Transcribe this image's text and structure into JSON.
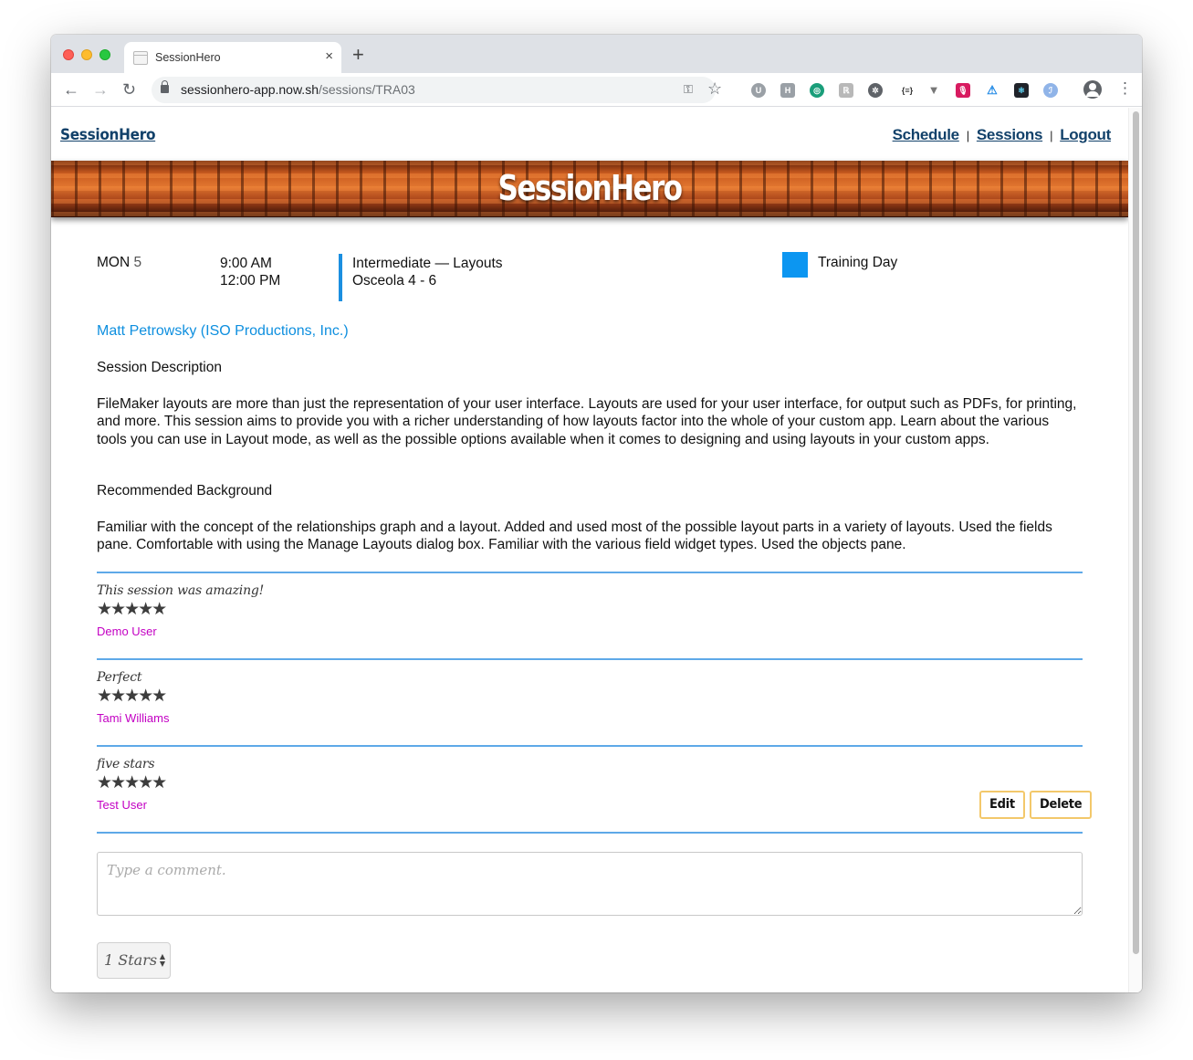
{
  "browser": {
    "tab_title": "SessionHero",
    "tab_close": "×",
    "new_tab": "+",
    "url_host": "sessionhero-app.now.sh",
    "url_path": "/sessions/TRA03",
    "nav_back": "←",
    "nav_forward": "→",
    "nav_reload": "↻",
    "menu": "⋮",
    "extensions": [
      "U",
      "H",
      "◎",
      "ℝ",
      "✲",
      "{≡}",
      "▼",
      "🎙",
      "⚠",
      "⚛",
      "ℐ"
    ]
  },
  "page": {
    "brand": "SessionHero",
    "nav": [
      "Schedule",
      "Sessions",
      "Logout"
    ],
    "nav_separator": "|",
    "hero_title": "SessionHero"
  },
  "session": {
    "day_name": "MON",
    "day_num": "5",
    "start_time": "9:00 AM",
    "end_time": "12:00 PM",
    "title": "Intermediate — Layouts",
    "room": "Osceola 4 - 6",
    "track": "Training Day",
    "track_color": "#0c96f1",
    "speaker": "Matt Petrowsky (ISO Productions, Inc.)",
    "description_heading": "Session Description",
    "description": "FileMaker layouts are more than just the representation of your user interface. Layouts are used for your user interface, for output such as PDFs, for printing, and more. This session aims to provide you with a richer understanding of how layouts factor into the whole of your custom app. Learn about the various tools you can use in Layout mode, as well as the possible options available when it comes to designing and using layouts in your custom apps.",
    "background_heading": "Recommended Background",
    "background": "Familiar with the concept of the relationships graph and a layout. Added and used most of the possible layout parts in a variety of layouts. Used the fields pane. Comfortable with using the Manage Layouts dialog box. Familiar with the various field widget types. Used the objects pane."
  },
  "reviews": [
    {
      "text": "This session was amazing!",
      "stars": "★★★★★",
      "rating": 5,
      "user": "Demo User"
    },
    {
      "text": "Perfect",
      "stars": "★★★★★",
      "rating": 5,
      "user": "Tami Williams"
    },
    {
      "text": "five stars",
      "stars": "★★★★★",
      "rating": 5,
      "user": "Test User",
      "edit_label": "Edit",
      "delete_label": "Delete"
    }
  ],
  "comment": {
    "placeholder": "Type a comment.",
    "rating_selected": "1 Stars"
  }
}
